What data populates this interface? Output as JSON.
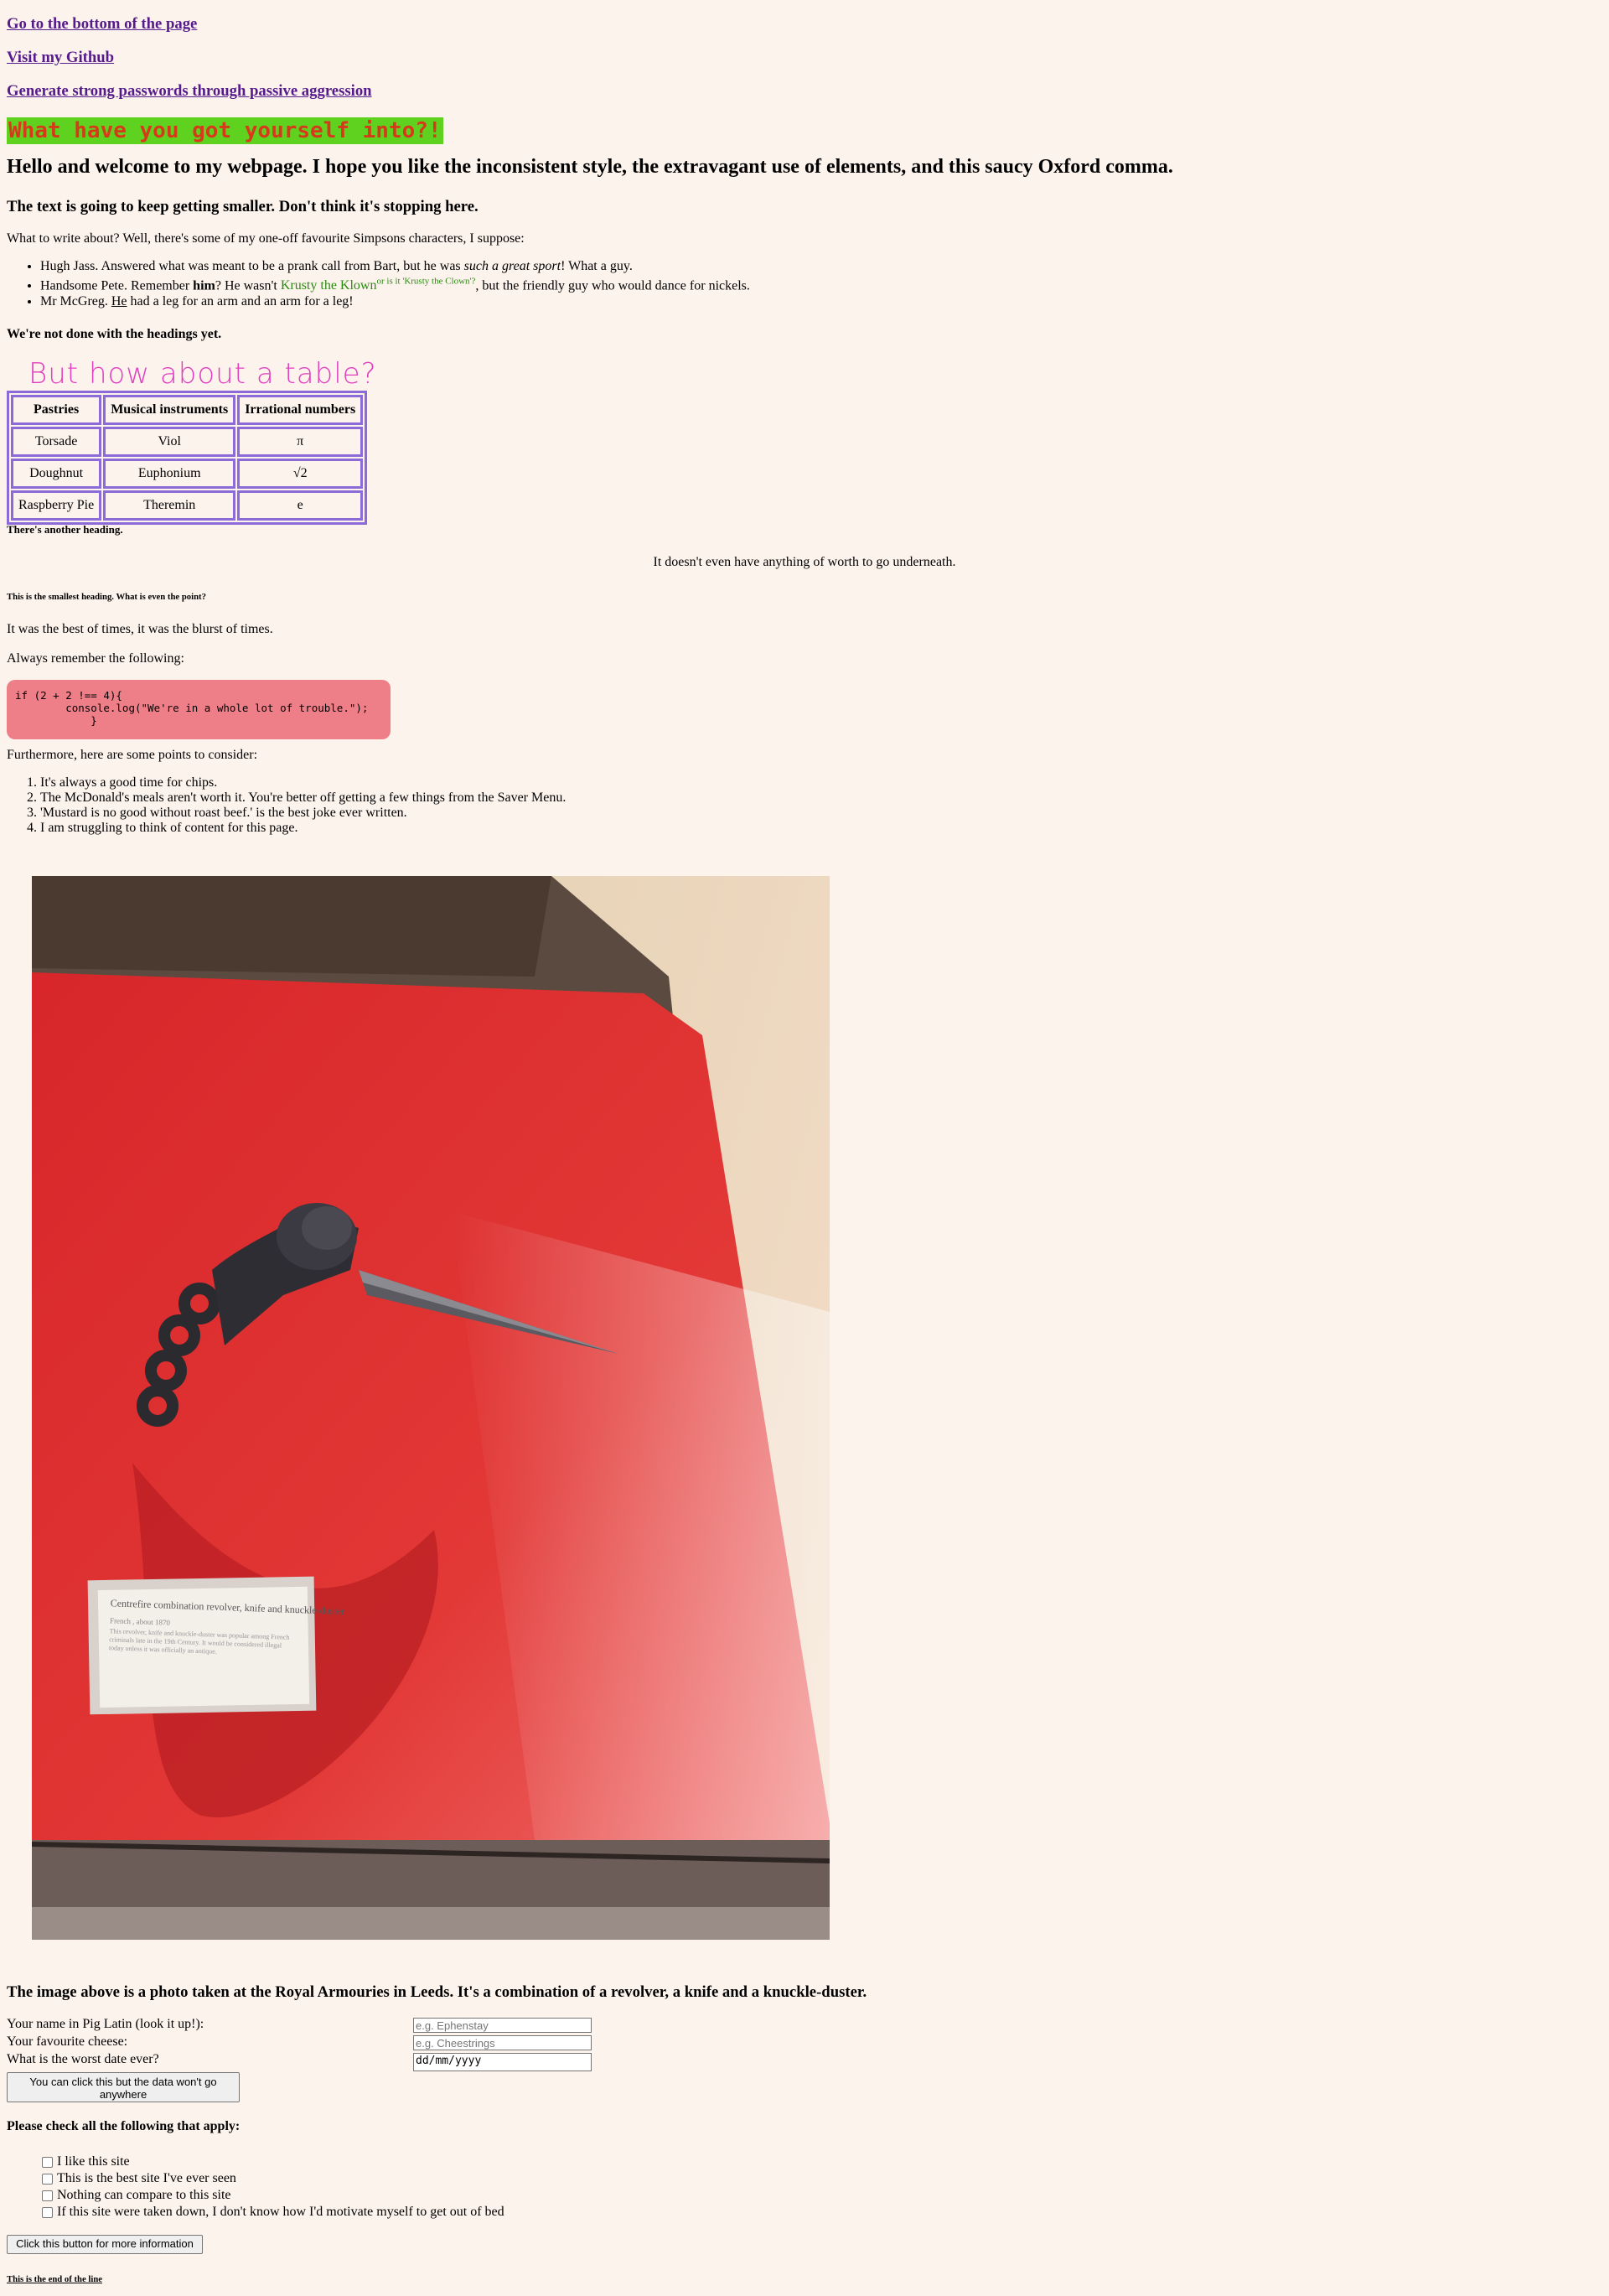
{
  "nav": {
    "bottom_link": "Go to the bottom of the page",
    "github_link": "Visit my Github",
    "passwords_link": "Generate strong passwords through passive aggression"
  },
  "headings": {
    "h1": "What have you got yourself into?!",
    "h2": "Hello and welcome to my webpage. I hope you like the inconsistent style, the extravagant use of elements, and this saucy Oxford comma.",
    "h3": "The text is going to keep getting smaller. Don't think it's stopping here.",
    "h4": "We're not done with the headings yet.",
    "table_heading": "But how about a table?",
    "h5": "There's another heading.",
    "h6": "This is the smallest heading. What is even the point?"
  },
  "simpsons": {
    "intro": "What to write about? Well, there's some of my one-off favourite Simpsons characters, I suppose:",
    "items": [
      {
        "a": "Hugh Jass. Answered what was meant to be a prank call from Bart, but he was ",
        "em": "such a great sport",
        "b": "! What a guy."
      },
      {
        "a": "Handsome Pete. Remember ",
        "strong": "him",
        "b": "? He wasn't ",
        "krusty": "Krusty the Klown",
        "sup": "or is it 'Krusty the Clown'?",
        "c": ", but the friendly guy who would dance for nickels."
      },
      {
        "a": "Mr McGreg. ",
        "u": "He",
        "b": " had a leg for an arm and an arm for a leg!"
      }
    ]
  },
  "table": {
    "headers": [
      "Pastries",
      "Musical instruments",
      "Irrational numbers"
    ],
    "rows": [
      [
        "Torsade",
        "Viol",
        "π"
      ],
      [
        "Doughnut",
        "Euphonium",
        "√2"
      ],
      [
        "Raspberry Pie",
        "Theremin",
        "e"
      ]
    ]
  },
  "center_text": "It doesn't even have anything of worth to go underneath.",
  "paragraphs": {
    "times": "It was the best of times, it was the blurst of times.",
    "remember": "Always remember the following:",
    "furthermore": "Furthermore, here are some points to consider:"
  },
  "code": "if (2 + 2 !== 4){\n        console.log(\"We're in a whole lot of trouble.\");\n            }",
  "points": [
    "It's always a good time for chips.",
    "The McDonald's meals aren't worth it. You're better off getting a few things from the Saver Menu.",
    "'Mustard is no good without roast beef.' is the best joke ever written.",
    "I am struggling to think of content for this page."
  ],
  "photo": {
    "placard_title": "Centrefire combination revolver, knife and knuckle-duster",
    "placard_sub": "French , about 1870",
    "placard_body": "This revolver, knife and knuckle-duster was popular among French criminals late in the 19th Century. It would be considered illegal today unless it was officially an antique."
  },
  "image_caption": "The image above is a photo taken at the Royal Armouries in Leeds. It's a combination of a revolver, a knife and a knuckle-duster.",
  "form": {
    "name_label": "Your name in Pig Latin (look it up!):",
    "name_placeholder": "e.g. Ephenstay",
    "cheese_label": "Your favourite cheese:",
    "cheese_placeholder": "e.g. Cheestrings",
    "date_label": "What is the worst date ever?",
    "date_value": "dd/mm/yyyy",
    "submit_label": "You can click this but the data won't go anywhere"
  },
  "checks": {
    "heading": "Please check all the following that apply:",
    "items": [
      "I like this site",
      "This is the best site I've ever seen",
      "Nothing can compare to this site",
      "If this site were taken down, I don't know how I'd motivate myself to get out of bed"
    ]
  },
  "more_info_button": "Click this button for more information",
  "end_heading": "This is the end of the line",
  "colors": {
    "background": "#fdf3ed",
    "link": "#551a8b",
    "h1_bg": "#5fd11f",
    "h1_text": "#d63a1a",
    "table_border": "#8c6bd8",
    "code_bg": "#ee7f88",
    "table_heading": "#e040c0"
  }
}
